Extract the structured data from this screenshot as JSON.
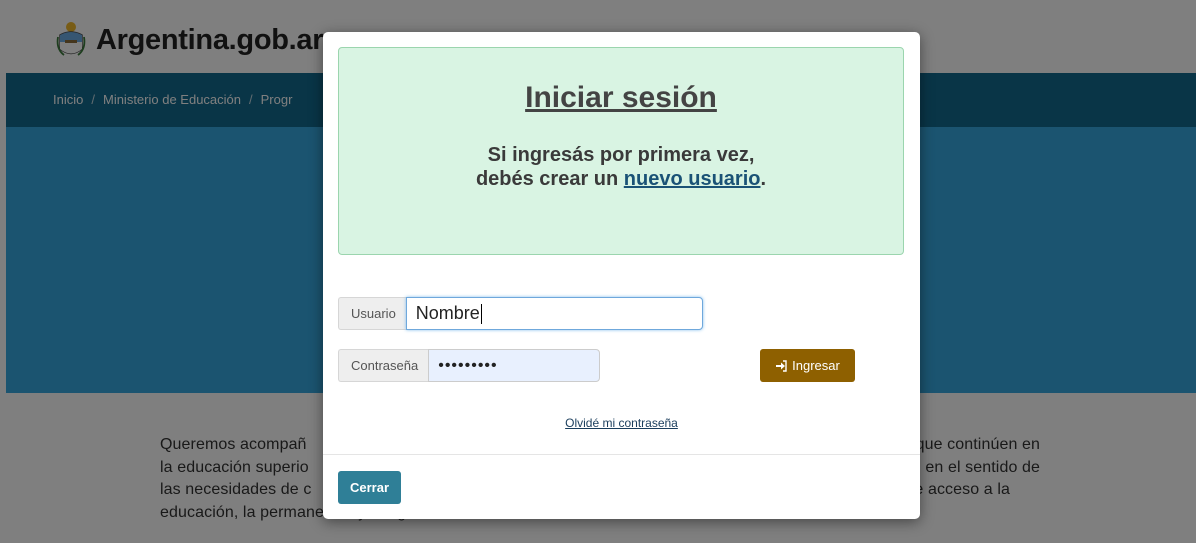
{
  "header": {
    "site_name": "Argentina.gob.ar",
    "logo_icon": "coat-of-arms-icon"
  },
  "breadcrumb": {
    "items": [
      "Inicio",
      "Ministerio de Educación",
      "Progr"
    ],
    "separator": "/"
  },
  "body_text": {
    "line1_start": "Queremos acompañ",
    "line1_end": "s, que continúen en",
    "line2_start": "la educación superio",
    "line2_end": "atal en el sentido de",
    "line3_start": "las necesidades de c",
    "line3_end": "s de acceso a la",
    "line4": "educación, la permanencia y el egreso."
  },
  "modal": {
    "title": "Iniciar sesión",
    "message_line1": "Si ingresás por primera vez,",
    "message_line2_prefix": "debés crear un ",
    "new_user_link": "nuevo usuario",
    "message_line2_suffix": ".",
    "username_label": "Usuario",
    "username_value": "Nombre",
    "password_label": "Contraseña",
    "password_value": "•••••••••",
    "submit_button": "Ingresar",
    "submit_icon": "sign-in-icon",
    "forgot_link": "Olvidé mi contraseña",
    "close_button": "Cerrar"
  },
  "colors": {
    "breadcrumb_bg": "#126a8e",
    "hero_bg": "#37a8e0",
    "alert_bg": "#d9f4e3",
    "submit_bg": "#8e6000",
    "close_bg": "#2f7f97"
  }
}
